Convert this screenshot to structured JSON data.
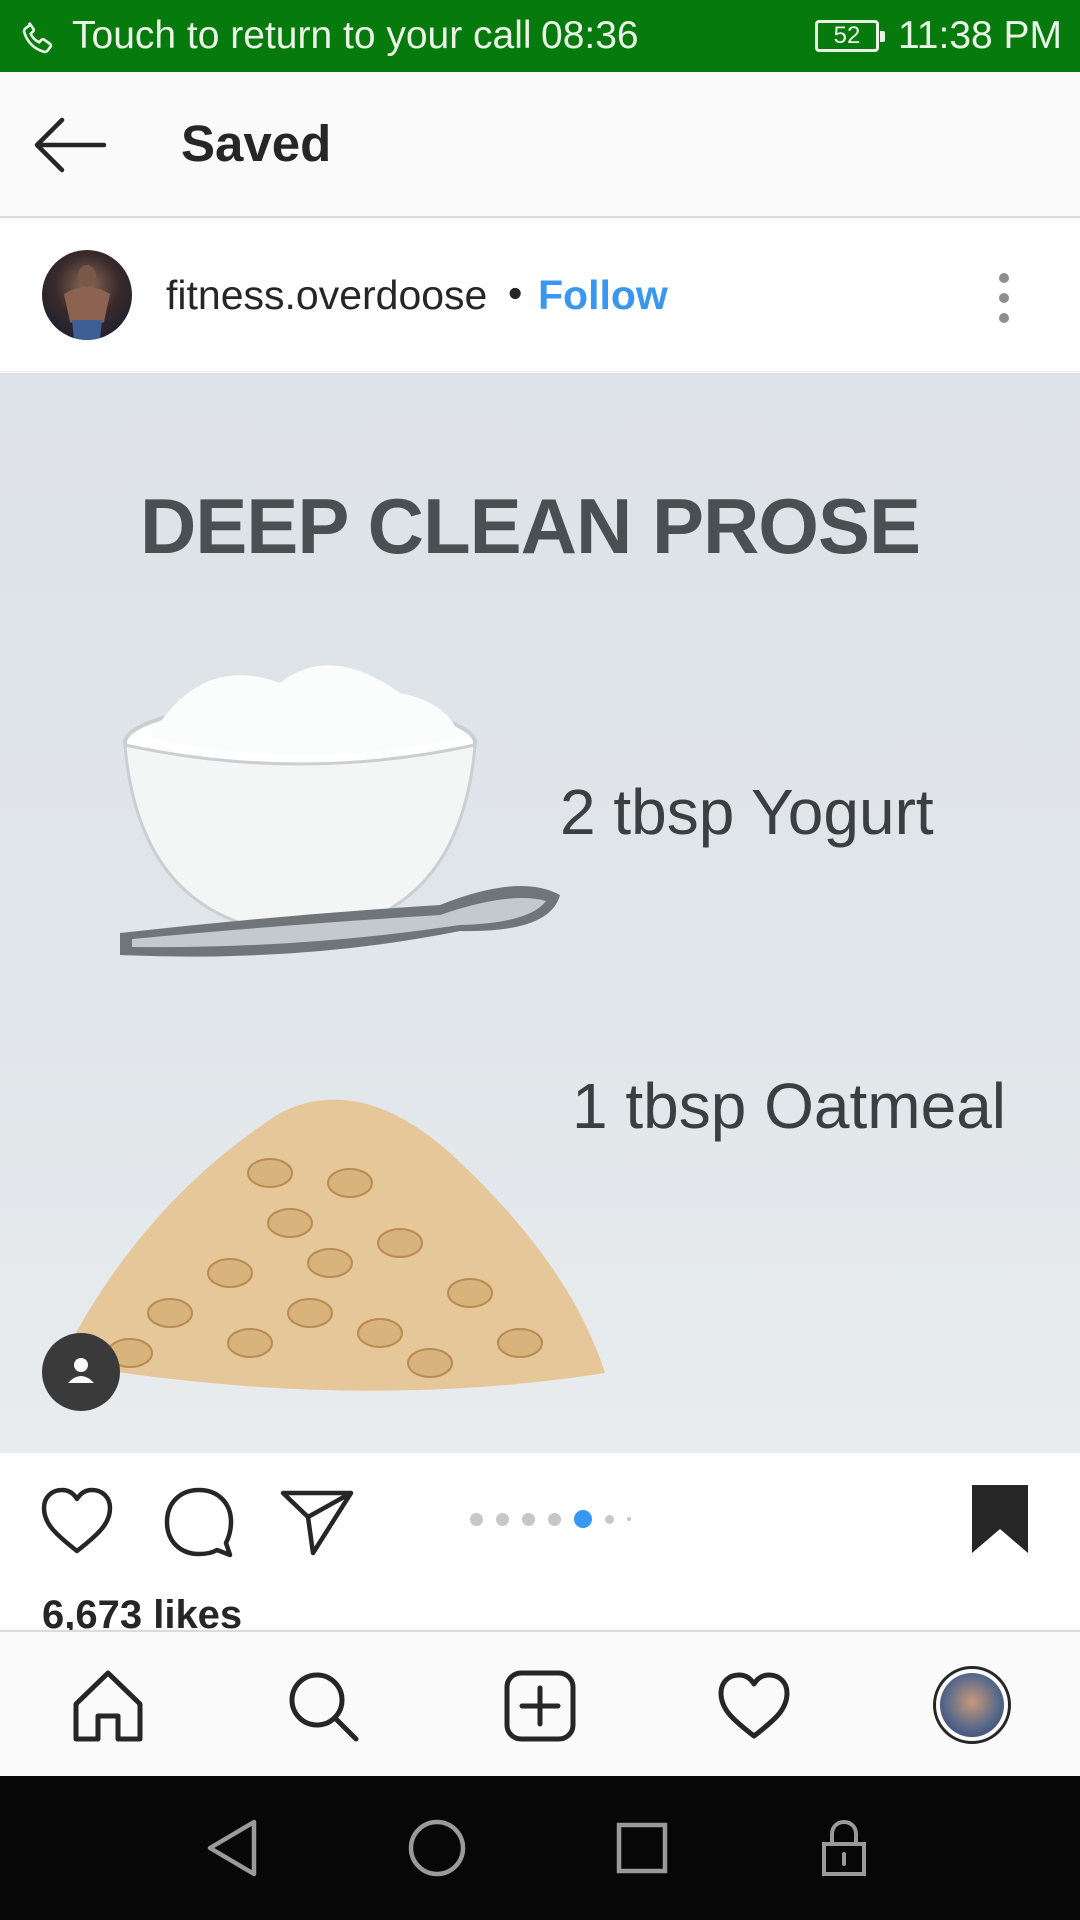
{
  "status_bar": {
    "call_text": "Touch to return to your call",
    "call_timer": "08:36",
    "battery": "52",
    "clock": "11:38 PM"
  },
  "header": {
    "title": "Saved"
  },
  "post": {
    "username": "fitness.overdoose",
    "separator": "•",
    "follow_label": "Follow",
    "image": {
      "title": "DEEP CLEAN PROSE",
      "line1": "2 tbsp   Yogurt",
      "line2": "1 tbsp Oatmeal"
    },
    "carousel": {
      "total": 7,
      "active_index": 4
    },
    "likes": "6,673 likes"
  },
  "colors": {
    "status_bar": "#067a0d",
    "link": "#3897f0",
    "text": "#262626"
  },
  "icons": {
    "header": [
      "back-arrow-icon"
    ],
    "post": [
      "more-options-icon",
      "user-tag-icon"
    ],
    "actions": [
      "heart-icon",
      "comment-icon",
      "share-icon",
      "bookmark-icon"
    ],
    "nav": [
      "home-icon",
      "search-icon",
      "add-post-icon",
      "activity-heart-icon",
      "profile-avatar"
    ],
    "system": [
      "system-back-icon",
      "system-home-icon",
      "system-recents-icon",
      "system-lock-icon"
    ]
  }
}
